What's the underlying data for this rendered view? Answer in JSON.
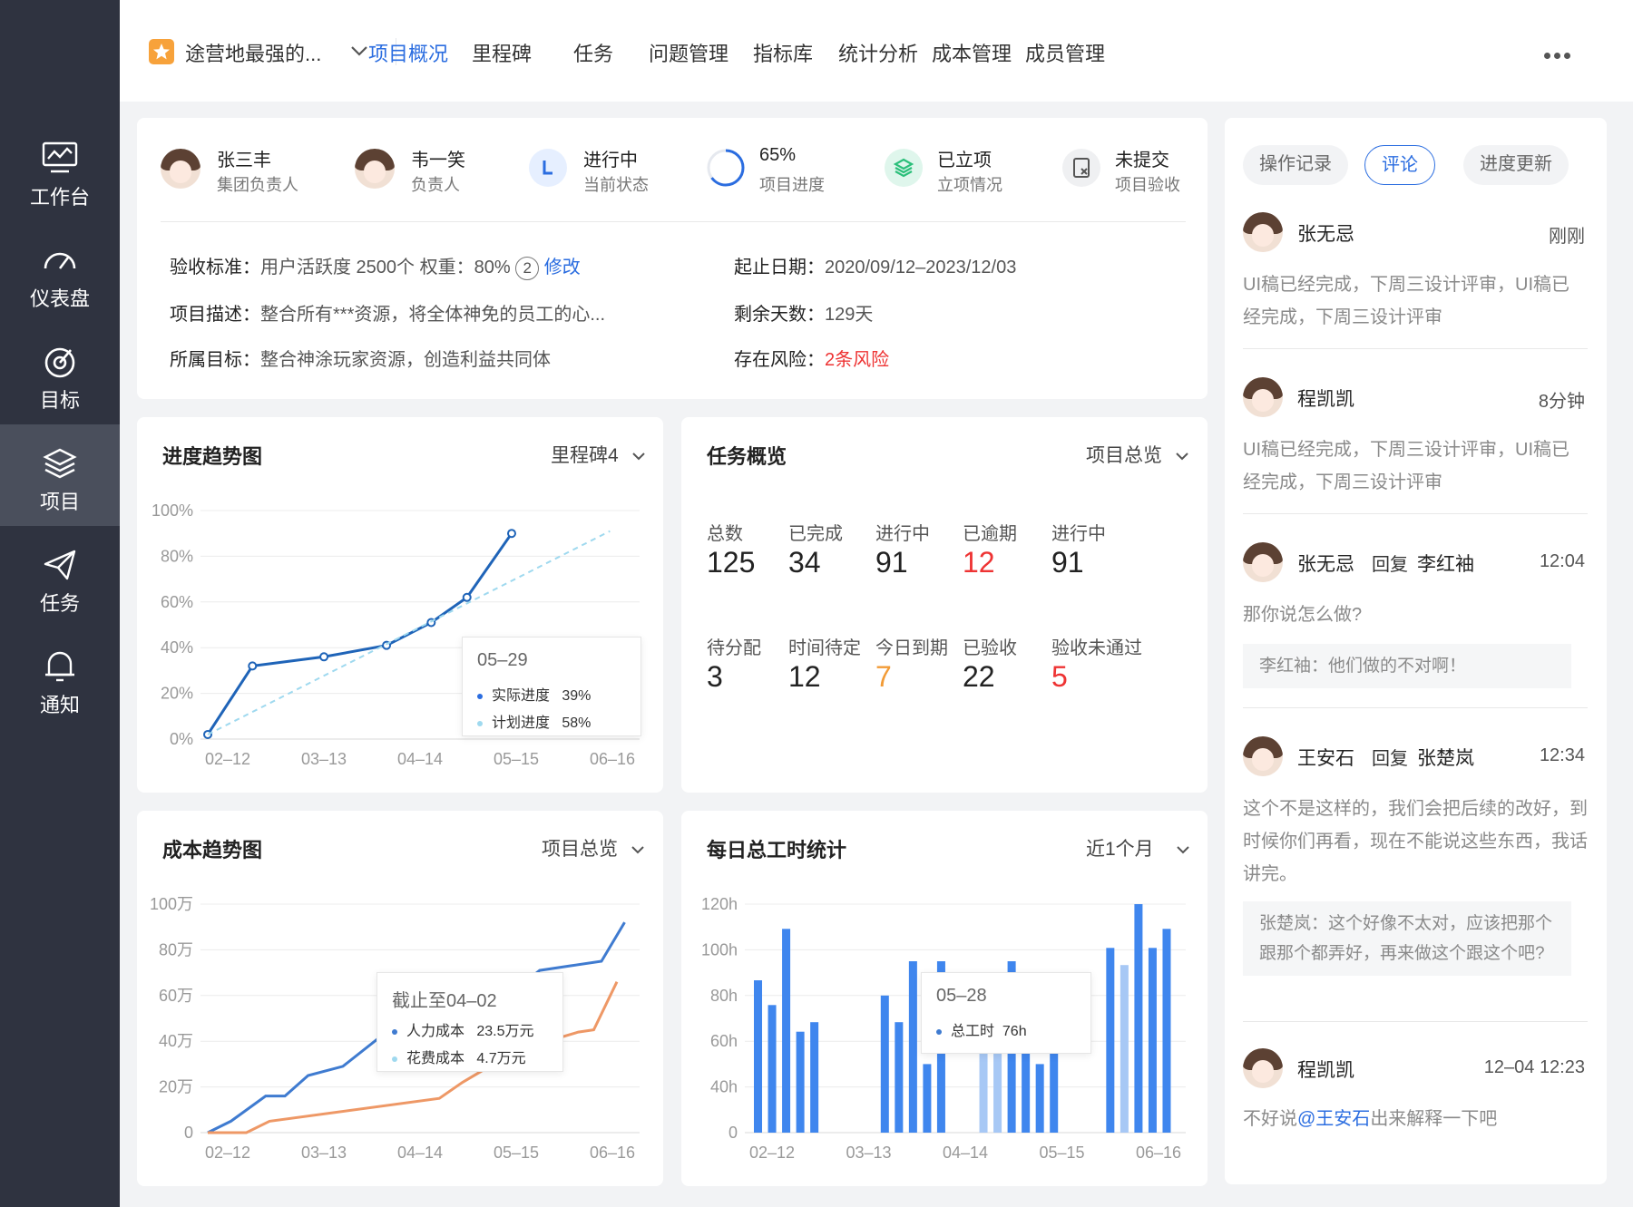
{
  "sidebar": {
    "items": [
      {
        "label": "工作台",
        "icon": "monitor-chart-icon"
      },
      {
        "label": "仪表盘",
        "icon": "gauge-icon"
      },
      {
        "label": "目标",
        "icon": "target-icon"
      },
      {
        "label": "项目",
        "icon": "layers-icon",
        "active": true
      },
      {
        "label": "任务",
        "icon": "paper-plane-icon"
      },
      {
        "label": "通知",
        "icon": "bell-icon"
      }
    ]
  },
  "topbar": {
    "project_name": "途营地最强的...",
    "tabs": [
      "项目概况",
      "里程碑",
      "任务",
      "问题管理",
      "指标库",
      "统计分析",
      "成本管理",
      "成员管理"
    ],
    "active_tab": "项目概况"
  },
  "summary": {
    "stats": [
      {
        "value": "张三丰",
        "sub": "集团负责人",
        "icon": "avatar"
      },
      {
        "value": "韦一笑",
        "sub": "负责人",
        "icon": "avatar"
      },
      {
        "value": "进行中",
        "sub": "当前状态",
        "icon": "status-L-icon"
      },
      {
        "value": "65%",
        "sub": "项目进度",
        "icon": "progress-ring-icon",
        "progress": 0.65
      },
      {
        "value": "已立项",
        "sub": "立项情况",
        "icon": "stack-check-icon"
      },
      {
        "value": "未提交",
        "sub": "项目验收",
        "icon": "document-x-icon"
      }
    ],
    "acceptance_label": "验收标准：",
    "acceptance_value": "用户活跃度  2500个  权重：80%",
    "acceptance_badge": "2",
    "acceptance_edit": "修改",
    "description_label": "项目描述：",
    "description_value": "整合所有***资源，将全体神免的员工的心...",
    "goal_label": "所属目标：",
    "goal_value": "整合神涂玩家资源，创造利益共同体",
    "dates_label": "起止日期：",
    "dates_value": "2020/09/12–2023/12/03",
    "remaining_label": "剩余天数：",
    "remaining_value": "129天",
    "risk_label": "存在风险：",
    "risk_value": "2条风险"
  },
  "progress_card": {
    "title": "进度趋势图",
    "select": "里程碑4",
    "tooltip": {
      "date": "05–29",
      "actual_label": "实际进度",
      "actual_value": "39%",
      "plan_label": "计划进度",
      "plan_value": "58%"
    }
  },
  "task_card": {
    "title": "任务概览",
    "select": "项目总览",
    "items": [
      {
        "label": "总数",
        "value": "125",
        "color": "normal"
      },
      {
        "label": "已完成",
        "value": "34",
        "color": "normal"
      },
      {
        "label": "进行中",
        "value": "91",
        "color": "normal"
      },
      {
        "label": "已逾期",
        "value": "12",
        "color": "red"
      },
      {
        "label": "进行中",
        "value": "91",
        "color": "normal"
      },
      {
        "label": "待分配",
        "value": "3",
        "color": "normal"
      },
      {
        "label": "时间待定",
        "value": "12",
        "color": "normal"
      },
      {
        "label": "今日到期",
        "value": "7",
        "color": "orange"
      },
      {
        "label": "已验收",
        "value": "22",
        "color": "normal"
      },
      {
        "label": "验收未通过",
        "value": "5",
        "color": "red"
      }
    ]
  },
  "cost_card": {
    "title": "成本趋势图",
    "select": "项目总览",
    "tooltip": {
      "date": "截止至04–02",
      "labor_label": "人力成本",
      "labor_value": "23.5万元",
      "spend_label": "花费成本",
      "spend_value": "4.7万元"
    }
  },
  "hours_card": {
    "title": "每日总工时统计",
    "select": "近1个月",
    "tooltip": {
      "date": "05–28",
      "label": "总工时",
      "value": "76h"
    }
  },
  "chart_data": [
    {
      "type": "line",
      "x_ticks": [
        "02–12",
        "03–13",
        "04–14",
        "05–15",
        "06–16"
      ],
      "y_ticks": [
        "100%",
        "80%",
        "60%",
        "40%",
        "20%",
        "0%"
      ],
      "ylim": [
        0,
        100
      ],
      "series": [
        {
          "name": "实际进度",
          "color": "#1f64b8",
          "x": [
            0,
            1,
            2.6,
            4,
            5,
            5.8,
            6.8
          ],
          "y": [
            2,
            32,
            36,
            41,
            51,
            62,
            90
          ]
        },
        {
          "name": "计划进度",
          "color": "#9fd9ef",
          "dashed": true,
          "x": [
            0,
            9.0
          ],
          "y": [
            2,
            91
          ]
        }
      ],
      "x_max": 9.5
    },
    {
      "type": "line",
      "x_ticks": [
        "02–12",
        "03–13",
        "04–14",
        "05–15",
        "06–16"
      ],
      "y_ticks": [
        "100万",
        "80万",
        "60万",
        "40万",
        "20万",
        "0"
      ],
      "ylim": [
        0,
        100
      ],
      "series": [
        {
          "name": "人力成本",
          "color": "#3f7bd0",
          "x": [
            0,
            0.3,
            0.75,
            1.0,
            1.3,
            1.75,
            2.2,
            2.75,
            3.2,
            4.0,
            4.3,
            4.7,
            5.1,
            5.4
          ],
          "y": [
            0,
            5,
            16,
            16,
            25,
            29,
            41,
            43,
            51,
            63,
            71,
            73,
            75,
            92
          ]
        },
        {
          "name": "花费成本",
          "color": "#ee9866",
          "x": [
            0,
            0.5,
            0.8,
            3.0,
            3.3,
            3.7,
            4.0,
            4.3,
            4.6,
            4.8,
            5.0,
            5.3
          ],
          "y": [
            0,
            0,
            5,
            15,
            22,
            30,
            34,
            37,
            42,
            44,
            45,
            66
          ]
        }
      ],
      "x_max": 5.5
    },
    {
      "type": "bar",
      "x_ticks": [
        "02–12",
        "03–13",
        "04–14",
        "05–15",
        "06–16"
      ],
      "y_ticks": [
        "120h",
        "100h",
        "80h",
        "60h",
        "40h",
        "0"
      ],
      "ylim": [
        0,
        120
      ],
      "values": [
        80,
        67,
        107,
        53,
        58,
        0,
        0,
        0,
        0,
        72,
        58,
        90,
        36,
        90,
        0,
        0,
        62,
        52,
        90,
        70,
        36,
        52,
        0,
        0,
        0,
        97,
        88,
        120,
        97,
        107
      ]
    }
  ],
  "comments": {
    "tabs": [
      "操作记录",
      "评论",
      "进度更新"
    ],
    "active_tab": "评论",
    "items": [
      {
        "name": "张无忌",
        "time": "刚刚",
        "text": "UI稿已经完成，下周三设计评审，UI稿已经完成，下周三设计评审"
      },
      {
        "name": "程凯凯",
        "time": "8分钟",
        "text": "UI稿已经完成，下周三设计评审，UI稿已经完成，下周三设计评审"
      },
      {
        "name": "张无忌",
        "reply": "回复",
        "target": "李红袖",
        "time": "12:04",
        "text": "那你说怎么做?",
        "quote": "李红袖：他们做的不对啊！"
      },
      {
        "name": "王安石",
        "reply": "回复",
        "target": "张楚岚",
        "time": "12:34",
        "text": "这个不是这样的，我们会把后续的改好，到时候你们再看，现在不能说这些东西，我话讲完。",
        "quote": "张楚岚：这个好像不太对，应该把那个跟那个都弄好，再来做这个跟这个吧?"
      },
      {
        "name": "程凯凯",
        "time": "12–04  12:23",
        "text_pre": "不好说",
        "mention": "@王安石",
        "text_post": "出来解释一下吧"
      }
    ]
  }
}
